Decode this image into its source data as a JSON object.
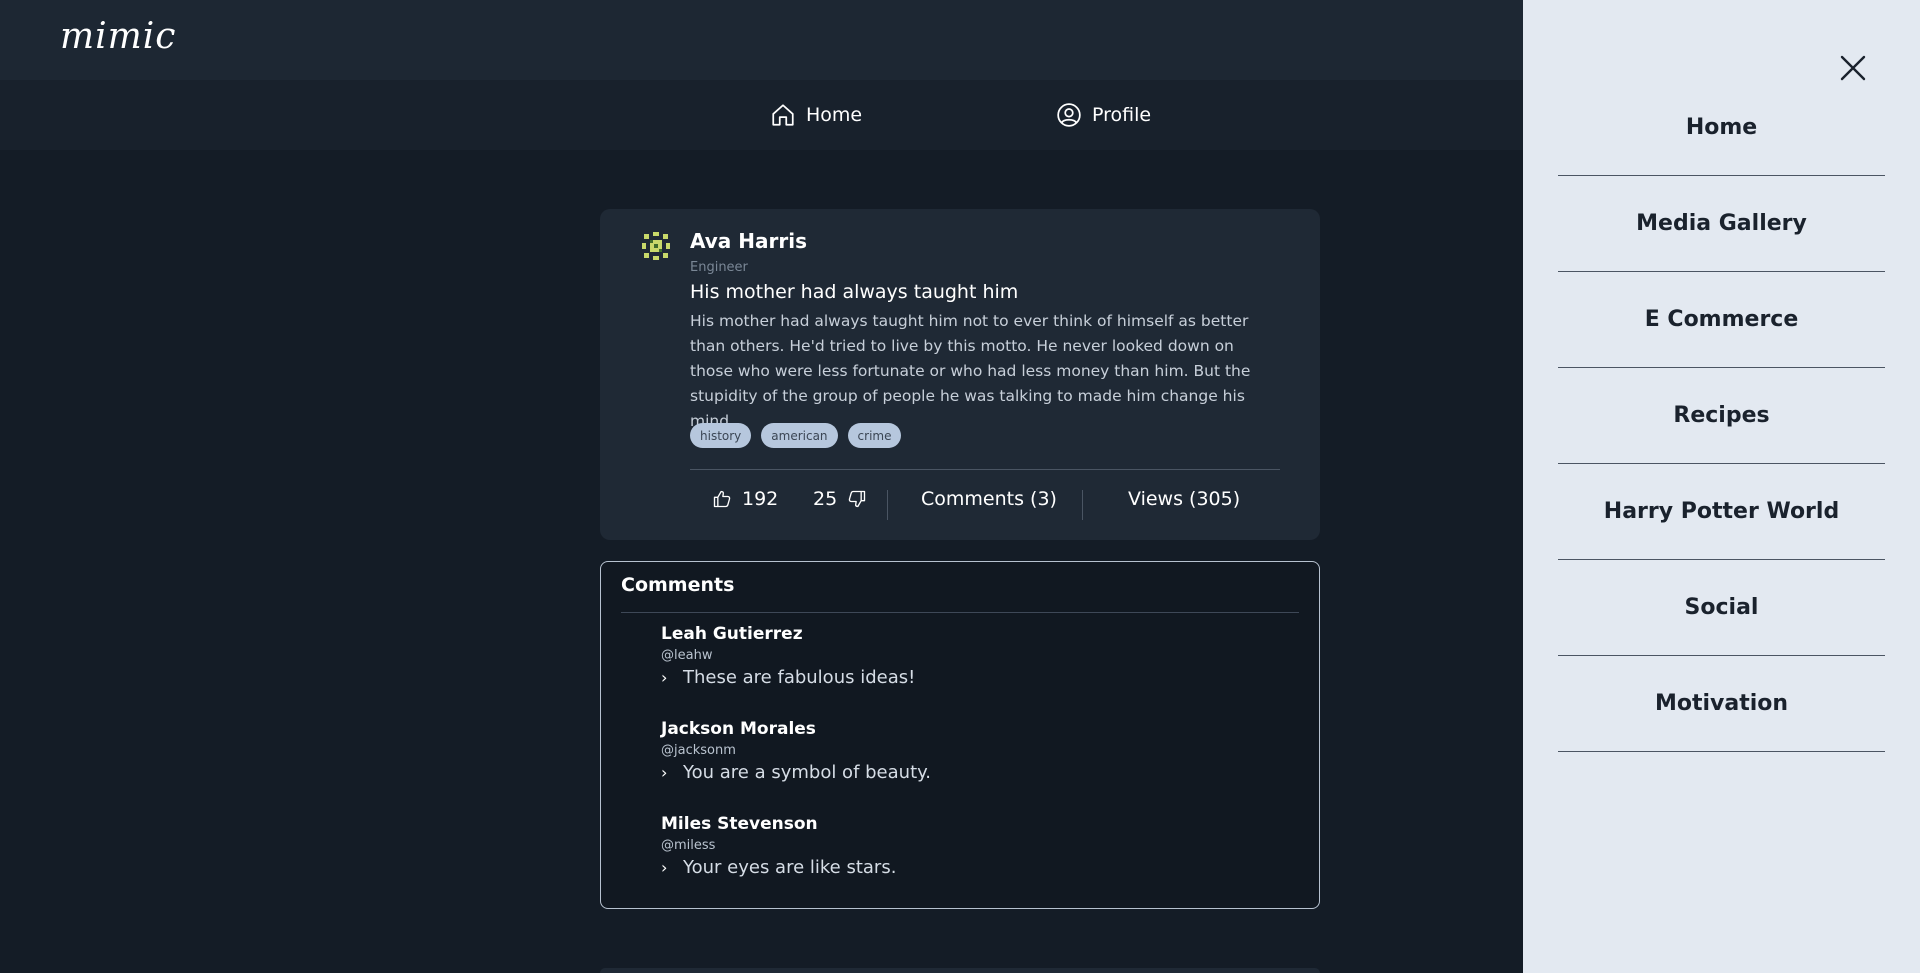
{
  "header": {
    "logo": "mimic"
  },
  "nav": {
    "home": "Home",
    "profile": "Profile"
  },
  "post": {
    "author": "Ava Harris",
    "role": "Engineer",
    "title": "His mother had always taught him",
    "body": "His mother had always taught him not to ever think of himself as better than others. He'd tried to live by this motto. He never looked down on those who were less fortunate or who had less money than him. But the stupidity of the group of people he was talking to made him change his mind.",
    "tags": [
      "history",
      "american",
      "crime"
    ],
    "likes": "192",
    "dislikes": "25",
    "comments_label": "Comments (3)",
    "views_label": "Views (305)"
  },
  "comments": {
    "header": "Comments",
    "items": [
      {
        "name": "Leah Gutierrez",
        "handle": "@leahw",
        "text": "These are fabulous ideas!"
      },
      {
        "name": "Jackson Morales",
        "handle": "@jacksonm",
        "text": "You are a symbol of beauty."
      },
      {
        "name": "Miles Stevenson",
        "handle": "@miless",
        "text": "Your eyes are like stars."
      }
    ]
  },
  "drawer": {
    "items": [
      "Home",
      "Media Gallery",
      "E Commerce",
      "Recipes",
      "Harry Potter World",
      "Social",
      "Motivation"
    ]
  },
  "colors": {
    "page_bg": "#141c26",
    "header_bg": "#1d2733",
    "card_bg": "#1f2935",
    "drawer_bg": "#e3e9f1",
    "tag_bg": "#b6c7dd"
  },
  "icons": {
    "home": "home-icon",
    "profile": "user-circle-icon",
    "like": "thumbs-up-icon",
    "dislike": "thumbs-down-icon",
    "close": "close-icon",
    "chevron": "chevron-right-icon"
  }
}
